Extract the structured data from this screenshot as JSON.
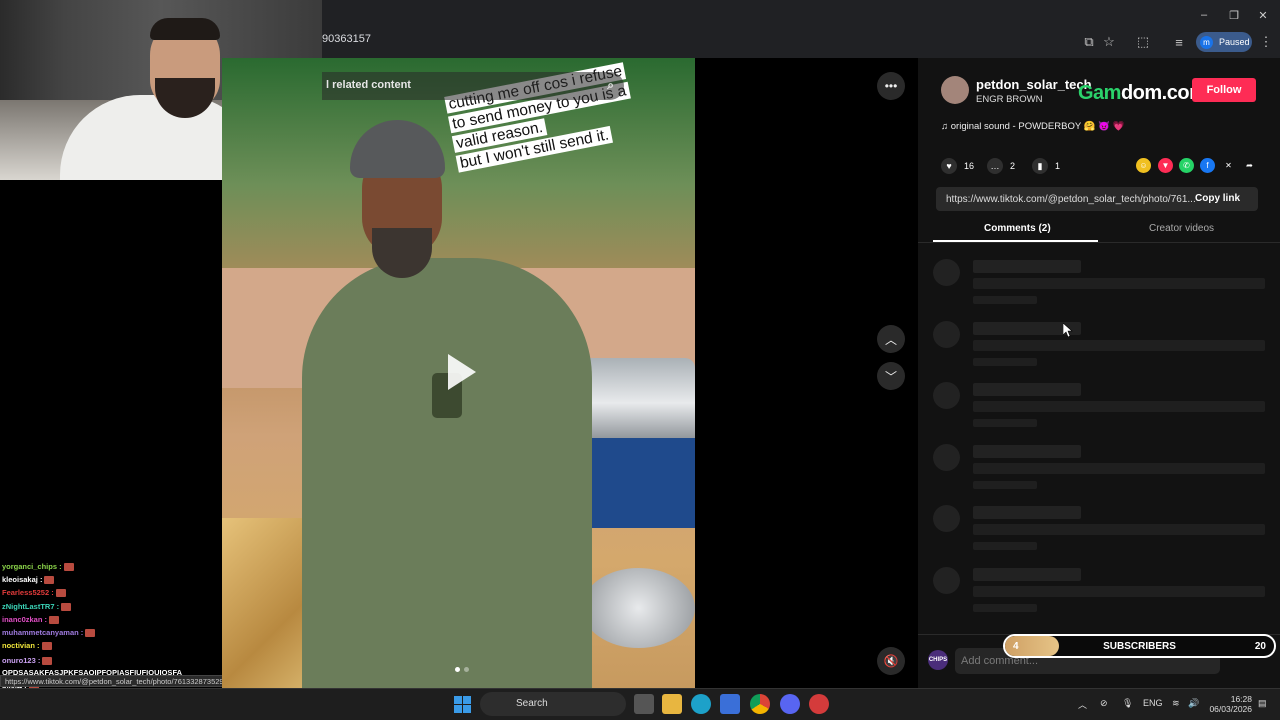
{
  "browser": {
    "address": "90363157",
    "profile_status": "Paused",
    "profile_initial": "m"
  },
  "chat": {
    "lines": [
      {
        "user": "yorganci_chips :",
        "color": "#8bd44a"
      },
      {
        "user": "kleoisakaj :",
        "color": "#ffffff"
      },
      {
        "user": "Fearless5252 :",
        "color": "#e23b3b"
      },
      {
        "user": "zNightLastTR7 :",
        "color": "#3bd5b8"
      },
      {
        "user": "inanc0zkan :",
        "color": "#e04ec4"
      },
      {
        "user": "muhammetcanyaman :",
        "color": "#a07be0"
      },
      {
        "user": "noctivian :",
        "color": "#f0e63b"
      },
      {
        "user": "onuro123 :",
        "color": "#c9a0f0"
      },
      {
        "user": "OPDSASAKFASJPKFSAOIPFOPIASFIUFIOUIOSFA",
        "color": "#ffffff"
      },
      {
        "user": "bilalff :",
        "color": "#ffffff"
      },
      {
        "user": "rostain :",
        "color": "#ffffff"
      }
    ],
    "status_url": "https://www.tiktok.com/@petdon_solar_tech/photo/7613328735290363157"
  },
  "post": {
    "search_placeholder": "l related content",
    "caption_lines": [
      "cutting me off cos i refuse",
      "to send money to you is a",
      "valid reason.",
      "but I won't still send it."
    ]
  },
  "panel": {
    "username": "petdon_solar_tech",
    "nickname": "ENGR BROWN",
    "overlay_brand_a": "Gam",
    "overlay_brand_b": "dom.com",
    "follow_label": "Follow",
    "music": "original sound - POWDERBOY 🤗 😈 💗",
    "likes": "16",
    "comments": "2",
    "saves": "1",
    "share_link": "https://www.tiktok.com/@petdon_solar_tech/photo/761...",
    "copy_label": "Copy link",
    "tabs": [
      "Comments (2)",
      "Creator videos"
    ],
    "comment_placeholder": "Add comment..."
  },
  "subs_widget": {
    "current": "4",
    "label": "SUBSCRIBERS",
    "goal": "20",
    "progress": 0.2,
    "chips_label": "CHIPS"
  },
  "taskbar": {
    "search_label": "Search",
    "lang": "ENG",
    "time": "16:28",
    "date": "06/03/2026"
  },
  "colors": {
    "follow": "#fe2c55",
    "panel_bg": "#121212",
    "brand_green": "#2bd26b"
  }
}
